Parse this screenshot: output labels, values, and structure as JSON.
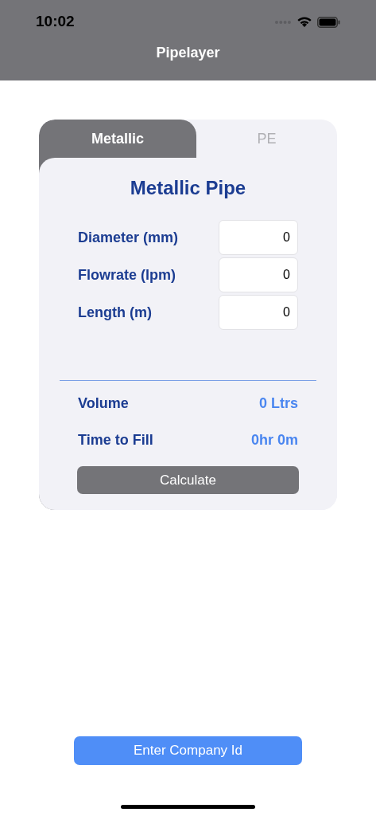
{
  "status_bar": {
    "time": "10:02"
  },
  "nav": {
    "title": "Pipelayer"
  },
  "tabs": [
    {
      "label": "Metallic",
      "selected": true
    },
    {
      "label": "PE",
      "selected": false
    }
  ],
  "card": {
    "title": "Metallic Pipe",
    "inputs": [
      {
        "label": "Diameter (mm)",
        "value": "0"
      },
      {
        "label": "Flowrate (lpm)",
        "value": "0"
      },
      {
        "label": "Length (m)",
        "value": "0"
      }
    ],
    "results": [
      {
        "label": "Volume",
        "value": "0 Ltrs"
      },
      {
        "label": "Time to Fill",
        "value": "0hr 0m"
      }
    ],
    "button": "Calculate"
  },
  "footer_button": "Enter Company Id"
}
